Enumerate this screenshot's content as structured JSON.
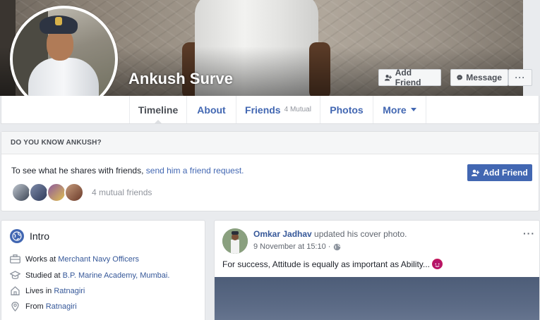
{
  "profile": {
    "name": "Ankush Surve"
  },
  "cover_actions": {
    "add_friend": "Add Friend",
    "message": "Message",
    "more": "···"
  },
  "nav": {
    "tabs": [
      {
        "label": "Timeline",
        "sub": ""
      },
      {
        "label": "About",
        "sub": ""
      },
      {
        "label": "Friends",
        "sub": "4 Mutual"
      },
      {
        "label": "Photos",
        "sub": ""
      },
      {
        "label": "More",
        "sub": ""
      }
    ]
  },
  "know": {
    "heading": "DO YOU KNOW ANKUSH?",
    "text_prefix": "To see what he shares with friends, ",
    "link": "send him a friend request.",
    "mutual": "4 mutual friends",
    "button": "Add Friend"
  },
  "intro": {
    "title": "Intro",
    "items": [
      {
        "prefix": "Works at ",
        "link": "Merchant Navy Officers",
        "icon": "briefcase-icon"
      },
      {
        "prefix": "Studied at ",
        "link": "B.P. Marine Academy, Mumbai.",
        "icon": "graduation-cap-icon"
      },
      {
        "prefix": "Lives in ",
        "link": "Ratnagiri",
        "icon": "home-icon"
      },
      {
        "prefix": "From ",
        "link": "Ratnagiri",
        "icon": "location-pin-icon"
      }
    ]
  },
  "post": {
    "author": "Omkar Jadhav",
    "action": " updated his cover photo.",
    "time": "9 November at 15:10 ·",
    "text": "For success, Attitude is equally as important as Ability...",
    "more": "···"
  },
  "colors": {
    "brand_blue": "#4267b2",
    "link_blue": "#365899",
    "background": "#e9ebee"
  }
}
